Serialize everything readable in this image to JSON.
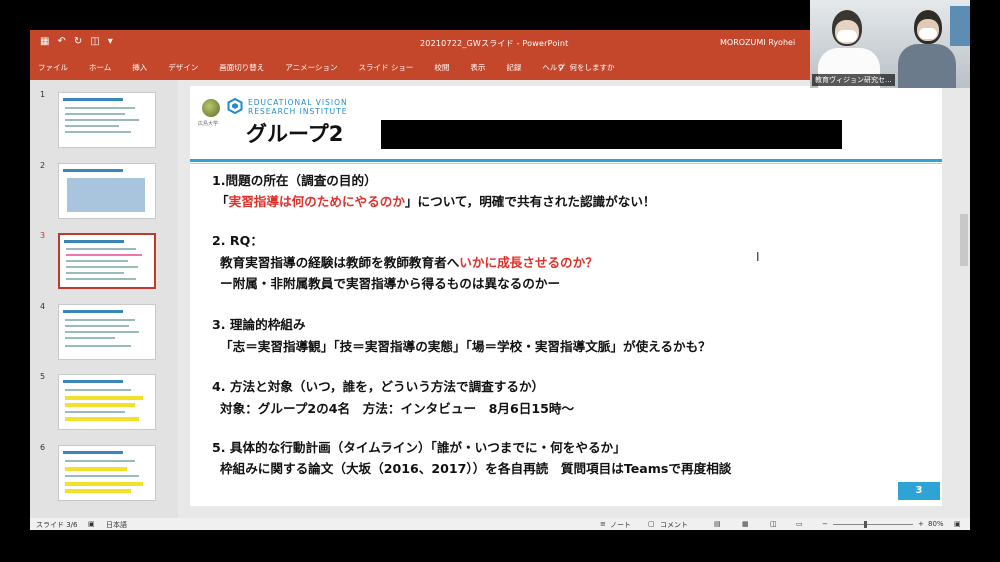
{
  "titlebar": {
    "doc_title": "20210722_GWスライド - PowerPoint",
    "user": "MOROZUMI Ryohei",
    "qat_icons": [
      "save-icon",
      "undo-icon",
      "redo-icon",
      "present-icon",
      "customize-icon"
    ]
  },
  "ribbon": {
    "tabs": [
      "ファイル",
      "ホーム",
      "挿入",
      "デザイン",
      "画面切り替え",
      "アニメーション",
      "スライド ショー",
      "校閲",
      "表示",
      "記録",
      "ヘルプ"
    ],
    "tell_me": "何をしますか"
  },
  "thumbnails": {
    "numbers": [
      "1",
      "2",
      "3",
      "4",
      "5",
      "6"
    ],
    "active": "3"
  },
  "slide": {
    "logo_caption": "広島大学",
    "evri_line1": "EDUCATIONAL VISION",
    "evri_line2": "RESEARCH INSTITUTE",
    "title": "グループ2",
    "s1_heading": "1.問題の所在（調査の目的）",
    "s1_text_open": "「",
    "s1_text_red": "実習指導は何のためにやるのか",
    "s1_text_rest": "」について，明確で共有された認識がない！",
    "s2_heading": "2. RQ：",
    "s2_text_main": "教育実習指導の経験は教師を教師教育者へ",
    "s2_text_red": "いかに成長させるのか？",
    "s2_sub": "ー附属・非附属教員で実習指導から得るものは異なるのかー",
    "s3_heading": "3. 理論的枠組み",
    "s3_text": "「志＝実習指導観」「技＝実習指導の実態」「場＝学校・実習指導文脈」が使えるかも？",
    "s4_heading": "4. 方法と対象（いつ，誰を，どういう方法で調査するか）",
    "s4_text": "対象：グループ2の4名　方法：インタビュー　8月6日15時～",
    "s5_heading": "5. 具体的な行動計画（タイムライン）「誰が・いつまでに・何をやるか」",
    "s5_text": "枠組みに関する論文（大坂（2016、2017））を各自再読　質問項目はTeamsで再度相談",
    "page_number": "3"
  },
  "status": {
    "slide_counter": "スライド 3/6",
    "language": "日本語",
    "notes": "ノート",
    "comments": "コメント",
    "zoom": "80%"
  },
  "webcam": {
    "label": "教育ヴィジョン研究セ..."
  }
}
